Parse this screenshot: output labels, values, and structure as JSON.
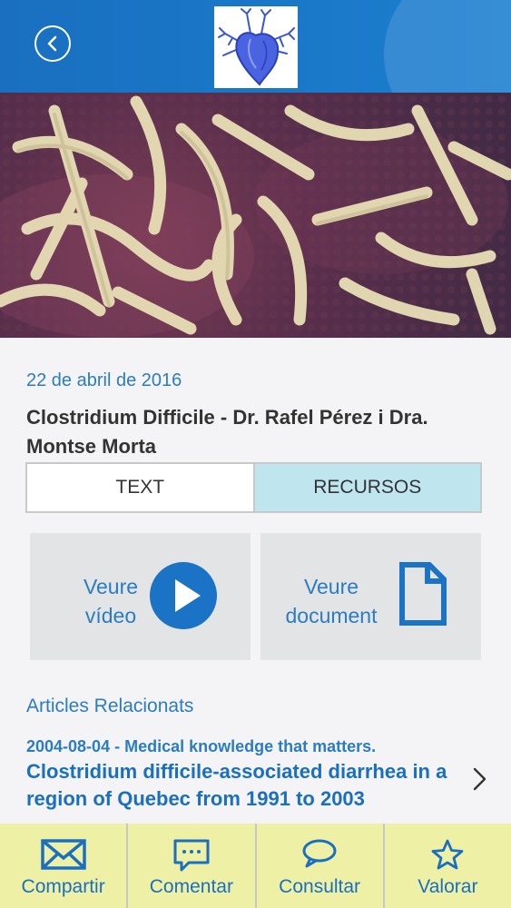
{
  "header": {
    "back_icon": "chevron-left-icon",
    "logo_icon": "heart-anatomy-icon"
  },
  "article": {
    "date": "22 de abril de 2016",
    "title": "Clostridium Difficile - Dr. Rafel Pérez i Dra. Montse Morta"
  },
  "tabs": [
    {
      "label": "TEXT",
      "selected": false
    },
    {
      "label": "RECURSOS",
      "selected": true
    }
  ],
  "resources": {
    "video": {
      "line1": "Veure",
      "line2": "vídeo",
      "icon": "play-icon"
    },
    "document": {
      "line1": "Veure",
      "line2": "document",
      "icon": "document-icon"
    }
  },
  "related": {
    "heading": "Articles Relacionats",
    "items": [
      {
        "meta": "2004-08-04 - Medical knowledge that matters.",
        "title": "Clostridium difficile-associated diarrhea in a region of Quebec from 1991 to 2003"
      }
    ]
  },
  "bottom_bar": [
    {
      "label": "Compartir",
      "icon": "envelope-icon"
    },
    {
      "label": "Comentar",
      "icon": "comment-icon"
    },
    {
      "label": "Consultar",
      "icon": "chat-bubble-icon"
    },
    {
      "label": "Valorar",
      "icon": "star-icon"
    }
  ],
  "colors": {
    "header": "#1b7fcf",
    "accent": "#2b7cc0",
    "tab_selected": "#bfe6ef",
    "bottom_bar": "#eef0a6"
  }
}
